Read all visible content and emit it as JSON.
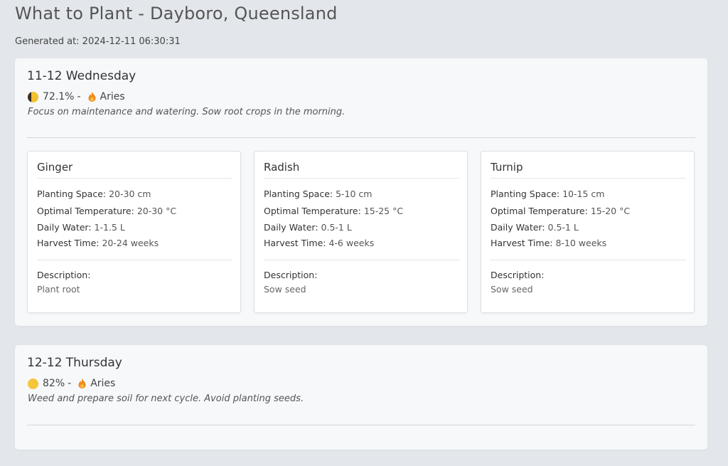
{
  "page": {
    "title": "What to Plant - Dayboro, Queensland",
    "generated": "Generated at: 2024-12-11 06:30:31"
  },
  "days": [
    {
      "date": "11-12 Wednesday",
      "moon_icon": "waxing-gibbous-moon-icon",
      "illumination": "72.1%",
      "separator": "-",
      "zodiac_icon": "fire-icon",
      "zodiac": "Aries",
      "advice": "Focus on maintenance and watering. Sow root crops in the morning.",
      "plants": [
        {
          "name": "Ginger",
          "space_label": "Planting Space:",
          "space": "20-30 cm",
          "temp_label": "Optimal Temperature:",
          "temp": "20-30 °C",
          "water_label": "Daily Water:",
          "water": "1-1.5 L",
          "harvest_label": "Harvest Time:",
          "harvest": "20-24 weeks",
          "desc_label": "Description:",
          "desc": "Plant root"
        },
        {
          "name": "Radish",
          "space_label": "Planting Space:",
          "space": "5-10 cm",
          "temp_label": "Optimal Temperature:",
          "temp": "15-25 °C",
          "water_label": "Daily Water:",
          "water": "0.5-1 L",
          "harvest_label": "Harvest Time:",
          "harvest": "4-6 weeks",
          "desc_label": "Description:",
          "desc": "Sow seed"
        },
        {
          "name": "Turnip",
          "space_label": "Planting Space:",
          "space": "10-15 cm",
          "temp_label": "Optimal Temperature:",
          "temp": "15-20 °C",
          "water_label": "Daily Water:",
          "water": "0.5-1 L",
          "harvest_label": "Harvest Time:",
          "harvest": "8-10 weeks",
          "desc_label": "Description:",
          "desc": "Sow seed"
        }
      ]
    },
    {
      "date": "12-12 Thursday",
      "moon_icon": "full-moon-icon",
      "illumination": "82%",
      "separator": "-",
      "zodiac_icon": "fire-icon",
      "zodiac": "Aries",
      "advice": "Weed and prepare soil for next cycle. Avoid planting seeds."
    }
  ],
  "colors": {
    "background": "#e3e7eb",
    "card": "#f6f8fa",
    "moon": "#f2c12e",
    "fire": "#f08a1c"
  }
}
